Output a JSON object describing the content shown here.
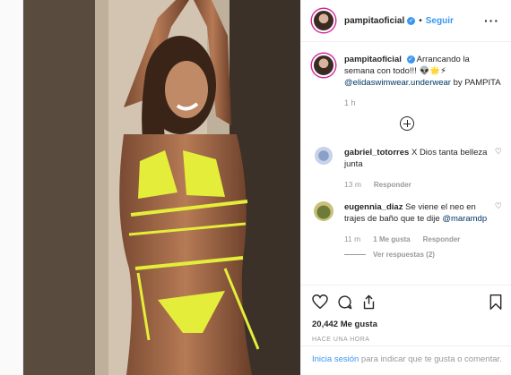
{
  "header": {
    "username": "pampitaoficial",
    "follow_label": "Seguir",
    "separator": "•"
  },
  "caption": {
    "username": "pampitaoficial",
    "text": "Arrancando la semana con todo!!! 👽🌟⚡",
    "mention": "@elidaswimwear.underwear",
    "suffix": "by PAMPITA",
    "time": "1 h"
  },
  "comments": [
    {
      "username": "gabriel_totorres",
      "text": "X Dios tanta belleza junta",
      "time": "13 m",
      "reply_label": "Responder"
    },
    {
      "username": "eugennia_diaz",
      "text": "Se viene el neo en trajes de baño que te dije",
      "mention": "@maramdp",
      "time": "11 m",
      "likes_label": "1 Me gusta",
      "reply_label": "Responder",
      "view_replies": "Ver respuestas (2)"
    }
  ],
  "stats": {
    "likes": "20,442 Me gusta",
    "posted": "HACE UNA HORA"
  },
  "login": {
    "link": "Inicia sesión",
    "text": "para indicar que te gusta o comentar."
  },
  "colors": {
    "accent": "#3897f0",
    "link": "#003569",
    "muted": "#999999",
    "text": "#262626"
  },
  "icons": [
    "verified-icon",
    "more-options-icon",
    "add-circle-icon",
    "heart-icon",
    "comment-icon",
    "share-icon",
    "bookmark-icon"
  ]
}
